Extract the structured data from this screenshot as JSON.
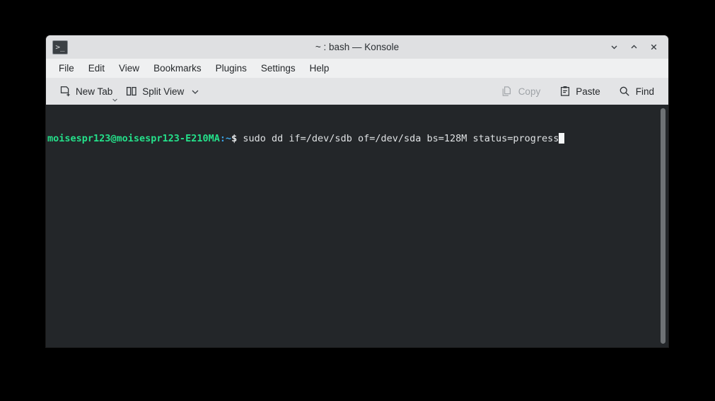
{
  "window": {
    "title": "~ : bash — Konsole",
    "tab_icon": "terminal-prompt-icon",
    "controls": {
      "minimize_label": "Minimize",
      "maximize_label": "Maximize",
      "close_label": "Close"
    }
  },
  "menubar": {
    "items": [
      {
        "label": "File"
      },
      {
        "label": "Edit"
      },
      {
        "label": "View"
      },
      {
        "label": "Bookmarks"
      },
      {
        "label": "Plugins"
      },
      {
        "label": "Settings"
      },
      {
        "label": "Help"
      }
    ]
  },
  "toolbar": {
    "new_tab_label": "New Tab",
    "split_view_label": "Split View",
    "copy_label": "Copy",
    "paste_label": "Paste",
    "find_label": "Find",
    "copy_disabled": true
  },
  "terminal": {
    "prompt_user_host": "moisespr123@moisespr123-E210MA",
    "prompt_colon": ":",
    "prompt_path": "~",
    "prompt_symbol": "$",
    "command": " sudo dd if=/dev/sdb of=/dev/sda bs=128M status=progress",
    "cursor_visible": true,
    "colors": {
      "background": "#232629",
      "foreground": "#fcfcfc",
      "prompt_user_color": "#24e08a",
      "prompt_path_color": "#3aa5e8",
      "cursor_color": "#f4f6f7"
    }
  }
}
